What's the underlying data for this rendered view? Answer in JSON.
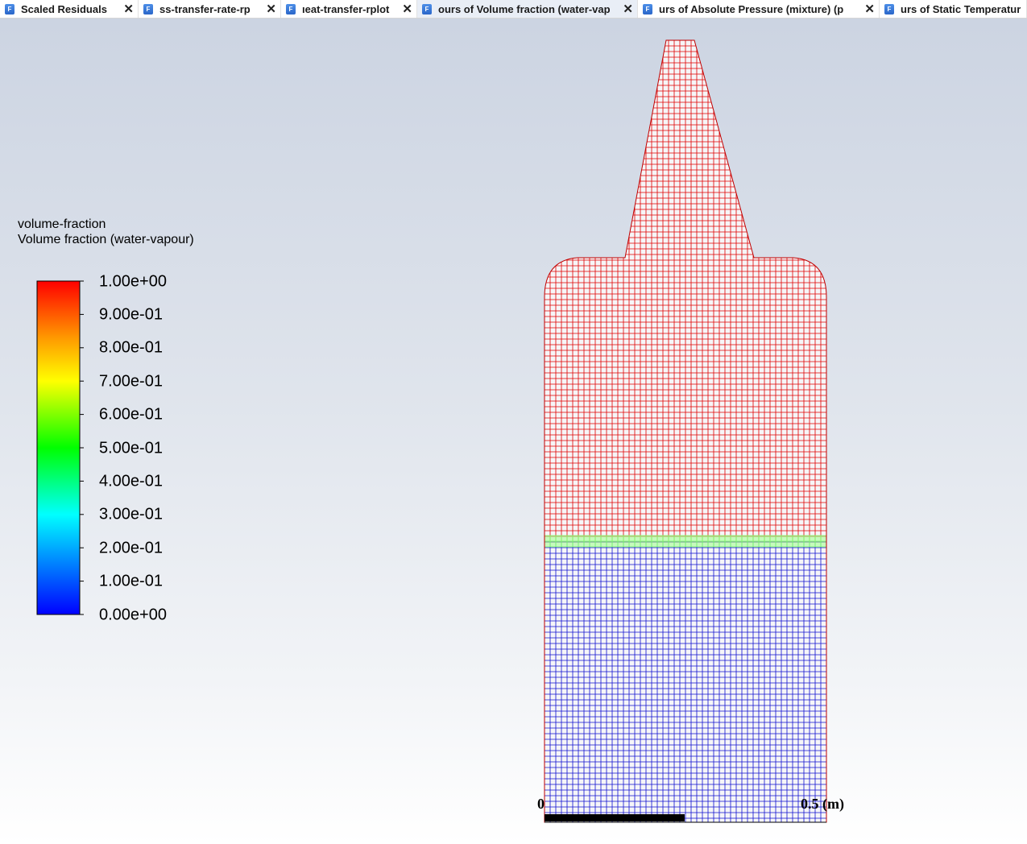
{
  "tabs": [
    {
      "label": "Scaled Residuals",
      "icon": "fluent-window-icon",
      "active": false
    },
    {
      "label": "ss-transfer-rate-rp",
      "icon": "fluent-window-icon",
      "active": false
    },
    {
      "label": "ıeat-transfer-rplot",
      "icon": "fluent-window-icon",
      "active": false
    },
    {
      "label": "ours of Volume fraction (water-vap",
      "icon": "fluent-window-icon",
      "active": true
    },
    {
      "label": "urs of Absolute Pressure (mixture)  (p",
      "icon": "fluent-window-icon",
      "active": false
    },
    {
      "label": "urs of Static Temperatur",
      "icon": "fluent-window-icon",
      "active": false
    }
  ],
  "legend": {
    "variable": "volume-fraction",
    "title": "Volume fraction (water-vapour)",
    "ticks": [
      "1.00e+00",
      "9.00e-01",
      "8.00e-01",
      "7.00e-01",
      "6.00e-01",
      "5.00e-01",
      "4.00e-01",
      "3.00e-01",
      "2.00e-01",
      "1.00e-01",
      "0.00e+00"
    ],
    "colormap": [
      "#0000ff",
      "#00aaff",
      "#00ffff",
      "#00ff00",
      "#ffff00",
      "#ff9900",
      "#ff0000"
    ]
  },
  "scale": {
    "start": "0",
    "end": "0.5 (m)"
  },
  "contour_colors": {
    "vapour": "#e00000",
    "interface": "#7cff6a",
    "liquid": "#1010d0"
  }
}
